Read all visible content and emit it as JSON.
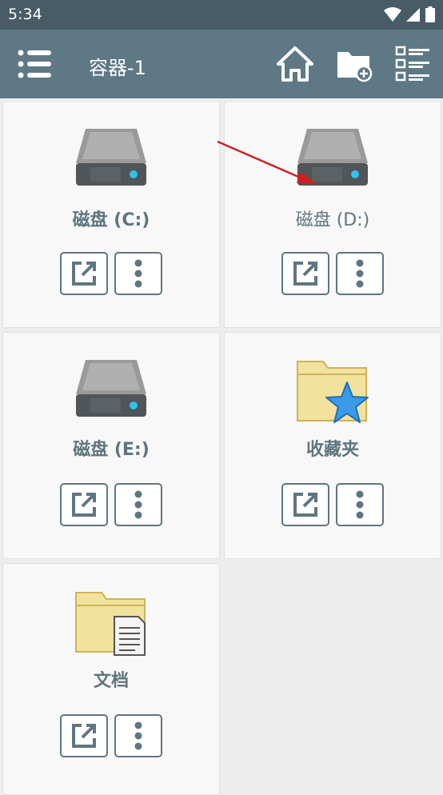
{
  "status_bar": {
    "time": "5:34",
    "icons": [
      "wifi-icon",
      "signal-icon",
      "battery-icon"
    ]
  },
  "toolbar": {
    "title": "容器-1",
    "icons": [
      "menu-icon",
      "home-icon",
      "new-folder-icon",
      "list-view-icon"
    ]
  },
  "items": [
    {
      "label": "磁盘 (C:)",
      "icon": "drive-icon"
    },
    {
      "label": "磁盘 (D:)",
      "icon": "drive-icon"
    },
    {
      "label": "磁盘 (E:)",
      "icon": "drive-icon"
    },
    {
      "label": "收藏夹",
      "icon": "favorites-folder-icon"
    },
    {
      "label": "文档",
      "icon": "documents-folder-icon"
    }
  ],
  "colors": {
    "status_bar": "#485c68",
    "toolbar": "#5e7886",
    "label": "#5f7581",
    "annotation_arrow": "#d11f1f"
  }
}
